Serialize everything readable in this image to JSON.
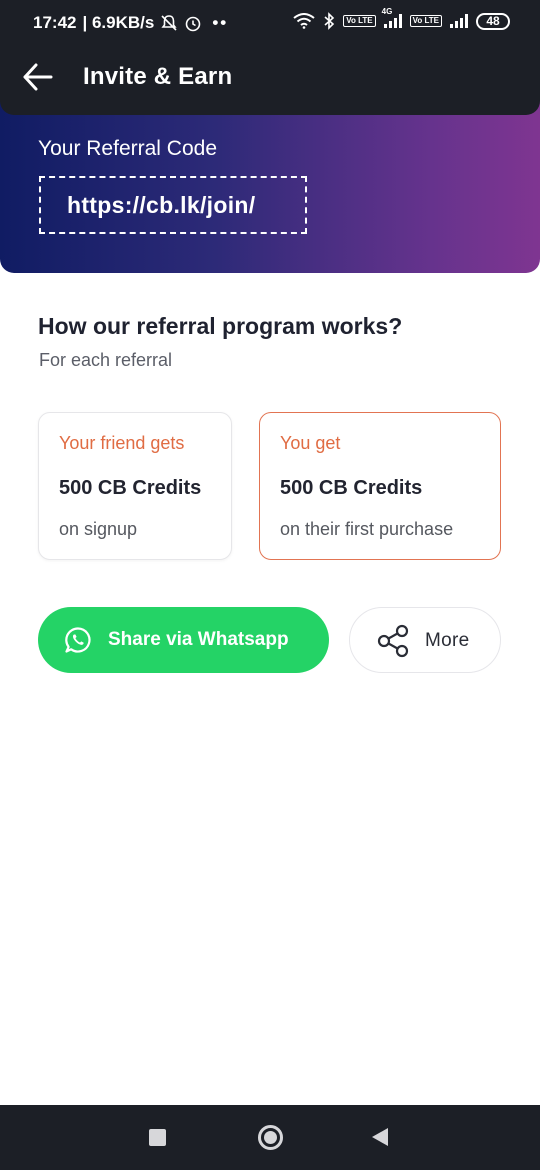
{
  "status_bar": {
    "time": "17:42",
    "net_speed": "| 6.9KB/s",
    "mute_icon": "mute-icon",
    "alarm_icon": "alarm-icon",
    "dots": "••",
    "network_4g": "4G",
    "volte": "Vo LTE",
    "battery": "48"
  },
  "app_bar": {
    "back_icon": "arrow-left-icon",
    "title": "Invite & Earn"
  },
  "referral": {
    "label": "Your Referral Code",
    "code": "https://cb.lk/join/"
  },
  "program": {
    "title": "How our referral program works?",
    "subtitle": "For each referral",
    "friend_card": {
      "heading": "Your friend gets",
      "amount": "500 CB Credits",
      "note": "on signup"
    },
    "you_card": {
      "heading": "You get",
      "amount": "500 CB Credits",
      "note": "on their first purchase"
    }
  },
  "actions": {
    "whatsapp_label": "Share via Whatsapp",
    "whatsapp_icon": "whatsapp-icon",
    "more_label": "More",
    "more_icon": "share-icon"
  },
  "colors": {
    "header_bg": "#1c1f26",
    "gradient_start": "#101c63",
    "gradient_end": "#7f3591",
    "accent_orange": "#e06c43",
    "whatsapp_green": "#24d366"
  }
}
